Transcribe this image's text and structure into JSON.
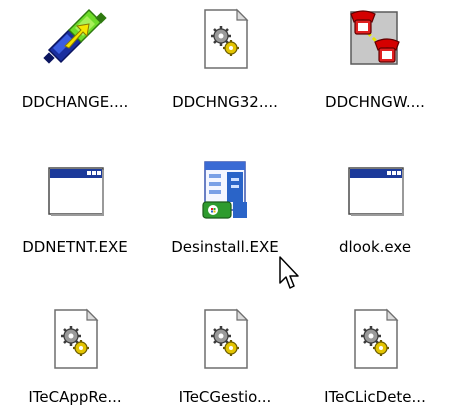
{
  "folder_view": {
    "items": [
      {
        "label": "DDCHANGE....",
        "icon": "cable-swap-icon"
      },
      {
        "label": "DDCHNG32....",
        "icon": "config-file-gear-icon"
      },
      {
        "label": "DDCHNGW....",
        "icon": "telephone-network-icon"
      },
      {
        "label": "DDNETNT.EXE",
        "icon": "window-application-icon"
      },
      {
        "label": "Desinstall.EXE",
        "icon": "start-menu-installer-icon"
      },
      {
        "label": "dlook.exe",
        "icon": "window-application-icon"
      },
      {
        "label": "ITeCAppRe...",
        "icon": "config-file-gear-icon"
      },
      {
        "label": "ITeCGestio...",
        "icon": "config-file-gear-icon"
      },
      {
        "label": "ITeCLicDete...",
        "icon": "config-file-gear-icon"
      }
    ]
  },
  "colors": {
    "window_icon_titlebar": "#1c3a9a",
    "gear_gold": "#d8b400",
    "phone_red": "#d40000",
    "start_blue": "#2a64c8",
    "start_green": "#2e9b2e"
  },
  "cursor": {
    "icon": "mouse-pointer-icon"
  }
}
